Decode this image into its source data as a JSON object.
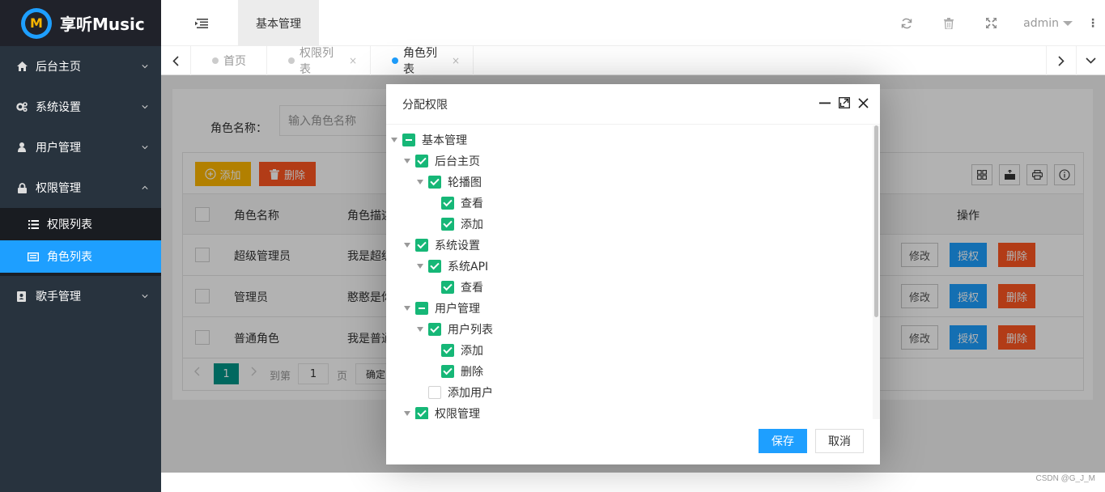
{
  "app": {
    "brand": "享听Music",
    "logo_letter": "M"
  },
  "sidebar": {
    "items": [
      {
        "label": "后台主页",
        "icon": "home-icon"
      },
      {
        "label": "系统设置",
        "icon": "gears-icon"
      },
      {
        "label": "用户管理",
        "icon": "user-icon"
      },
      {
        "label": "权限管理",
        "icon": "lock-icon"
      }
    ],
    "sub_items": [
      {
        "label": "权限列表",
        "icon": "list-icon"
      },
      {
        "label": "角色列表",
        "icon": "card-icon"
      }
    ],
    "last_item": {
      "label": "歌手管理",
      "icon": "address-book-icon"
    }
  },
  "header": {
    "top_tab": "基本管理",
    "user": "admin",
    "more": "⋮"
  },
  "tabs": {
    "items": [
      {
        "label": "首页",
        "close": ""
      },
      {
        "label": "权限列表",
        "close": "×"
      },
      {
        "label": "角色列表",
        "close": "×"
      }
    ]
  },
  "search": {
    "label": "角色名称：",
    "placeholder": "输入角色名称"
  },
  "toolbar": {
    "add_label": "添加",
    "del_label": "删除"
  },
  "table": {
    "columns": [
      "角色名称",
      "角色描述",
      "操作"
    ],
    "rows": [
      {
        "name": "超级管理员",
        "desc": "我是超级"
      },
      {
        "name": "管理员",
        "desc": "憨憨是你"
      },
      {
        "name": "普通角色",
        "desc": "我是普通"
      }
    ],
    "actions": {
      "edit": "修改",
      "auth": "授权",
      "remove": "删除"
    }
  },
  "pager": {
    "current": "1",
    "goto_label": "到第",
    "goto_value": "1",
    "page_label": "页",
    "confirm": "确定"
  },
  "modal": {
    "title": "分配权限",
    "tree": [
      {
        "label": "基本管理",
        "state": "half"
      },
      {
        "label": "后台主页",
        "state": "full"
      },
      {
        "label": "轮播图",
        "state": "full"
      },
      {
        "label": "查看",
        "state": "full"
      },
      {
        "label": "添加",
        "state": "full"
      },
      {
        "label": "系统设置",
        "state": "full"
      },
      {
        "label": "系统API",
        "state": "full"
      },
      {
        "label": "查看",
        "state": "full"
      },
      {
        "label": "用户管理",
        "state": "half"
      },
      {
        "label": "用户列表",
        "state": "full"
      },
      {
        "label": "添加",
        "state": "full"
      },
      {
        "label": "删除",
        "state": "full"
      },
      {
        "label": "添加用户",
        "state": "none"
      },
      {
        "label": "权限管理",
        "state": "full"
      }
    ],
    "save": "保存",
    "cancel": "取消"
  },
  "watermark": "CSDN @G_J_M",
  "colors": {
    "primary": "#1e9fff",
    "danger": "#ff5722",
    "warn": "#ffb800",
    "check": "#16b777",
    "pager": "#009688"
  }
}
